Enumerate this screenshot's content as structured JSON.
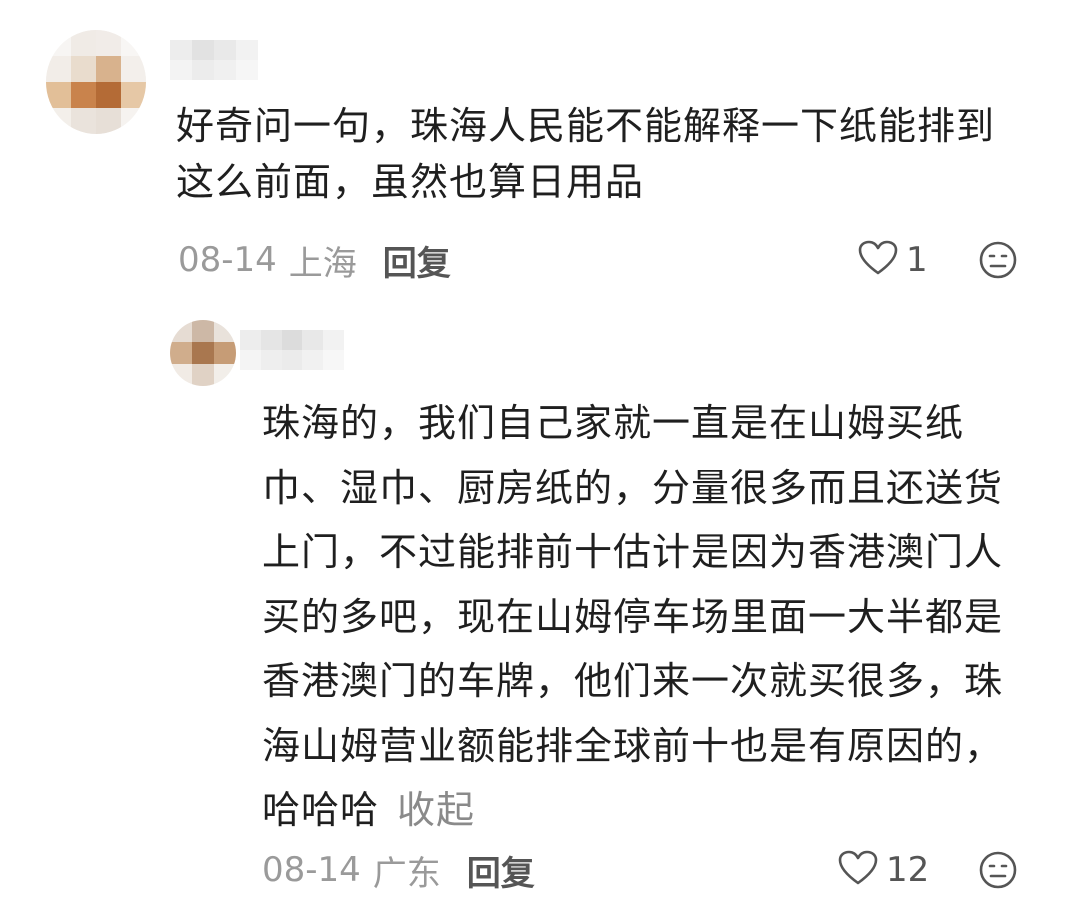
{
  "comments": [
    {
      "text_lines": [
        "好奇问一句，珠海人民能不能解释一下纸能排到",
        "这么前面，虽然也算日用品"
      ],
      "date": "08-14",
      "location": "上海",
      "reply_label": "回复",
      "like_count": "1",
      "like_icon": "heart-outline-icon",
      "reaction_icon": "neutral-face-icon"
    }
  ],
  "replies": [
    {
      "text_lines": [
        "珠海的，我们自己家就一直是在山姆买纸",
        "巾、湿巾、厨房纸的，分量很多而且还送货",
        "上门，不过能排前十估计是因为香港澳门人",
        "买的多吧，现在山姆停车场里面一大半都是",
        "香港澳门的车牌，他们来一次就买很多，珠",
        "海山姆营业额能排全球前十也是有原因的，",
        "哈哈哈"
      ],
      "collapse_label": "收起",
      "date": "08-14",
      "location": "广东",
      "reply_label": "回复",
      "like_count": "12",
      "like_icon": "heart-outline-icon",
      "reaction_icon": "neutral-face-icon"
    }
  ],
  "colors": {
    "text": "#1f1f1f",
    "meta": "#9a9a9a",
    "action": "#555555",
    "collapse": "#8a8a8a",
    "background": "#ffffff"
  }
}
